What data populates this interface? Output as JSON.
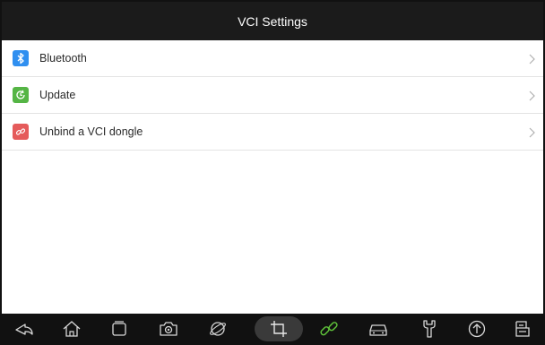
{
  "header": {
    "title": "VCI Settings"
  },
  "menu": {
    "items": [
      {
        "label": "Bluetooth",
        "icon": "bluetooth-icon",
        "color": "#2f8ff0"
      },
      {
        "label": "Update",
        "icon": "update-icon",
        "color": "#55b545"
      },
      {
        "label": "Unbind a VCI dongle",
        "icon": "unlink-icon",
        "color": "#e55b5b"
      }
    ]
  },
  "navbar": {
    "buttons": [
      {
        "icon": "back-icon"
      },
      {
        "icon": "home-icon"
      },
      {
        "icon": "recent-apps-icon"
      },
      {
        "icon": "camera-icon"
      },
      {
        "icon": "browser-icon"
      },
      {
        "icon": "crop-icon",
        "active": true
      },
      {
        "icon": "vci-link-icon",
        "color": "#5fc23a"
      },
      {
        "icon": "car-icon"
      },
      {
        "icon": "wrench-icon"
      },
      {
        "icon": "upload-icon"
      },
      {
        "icon": "report-icon"
      }
    ]
  }
}
